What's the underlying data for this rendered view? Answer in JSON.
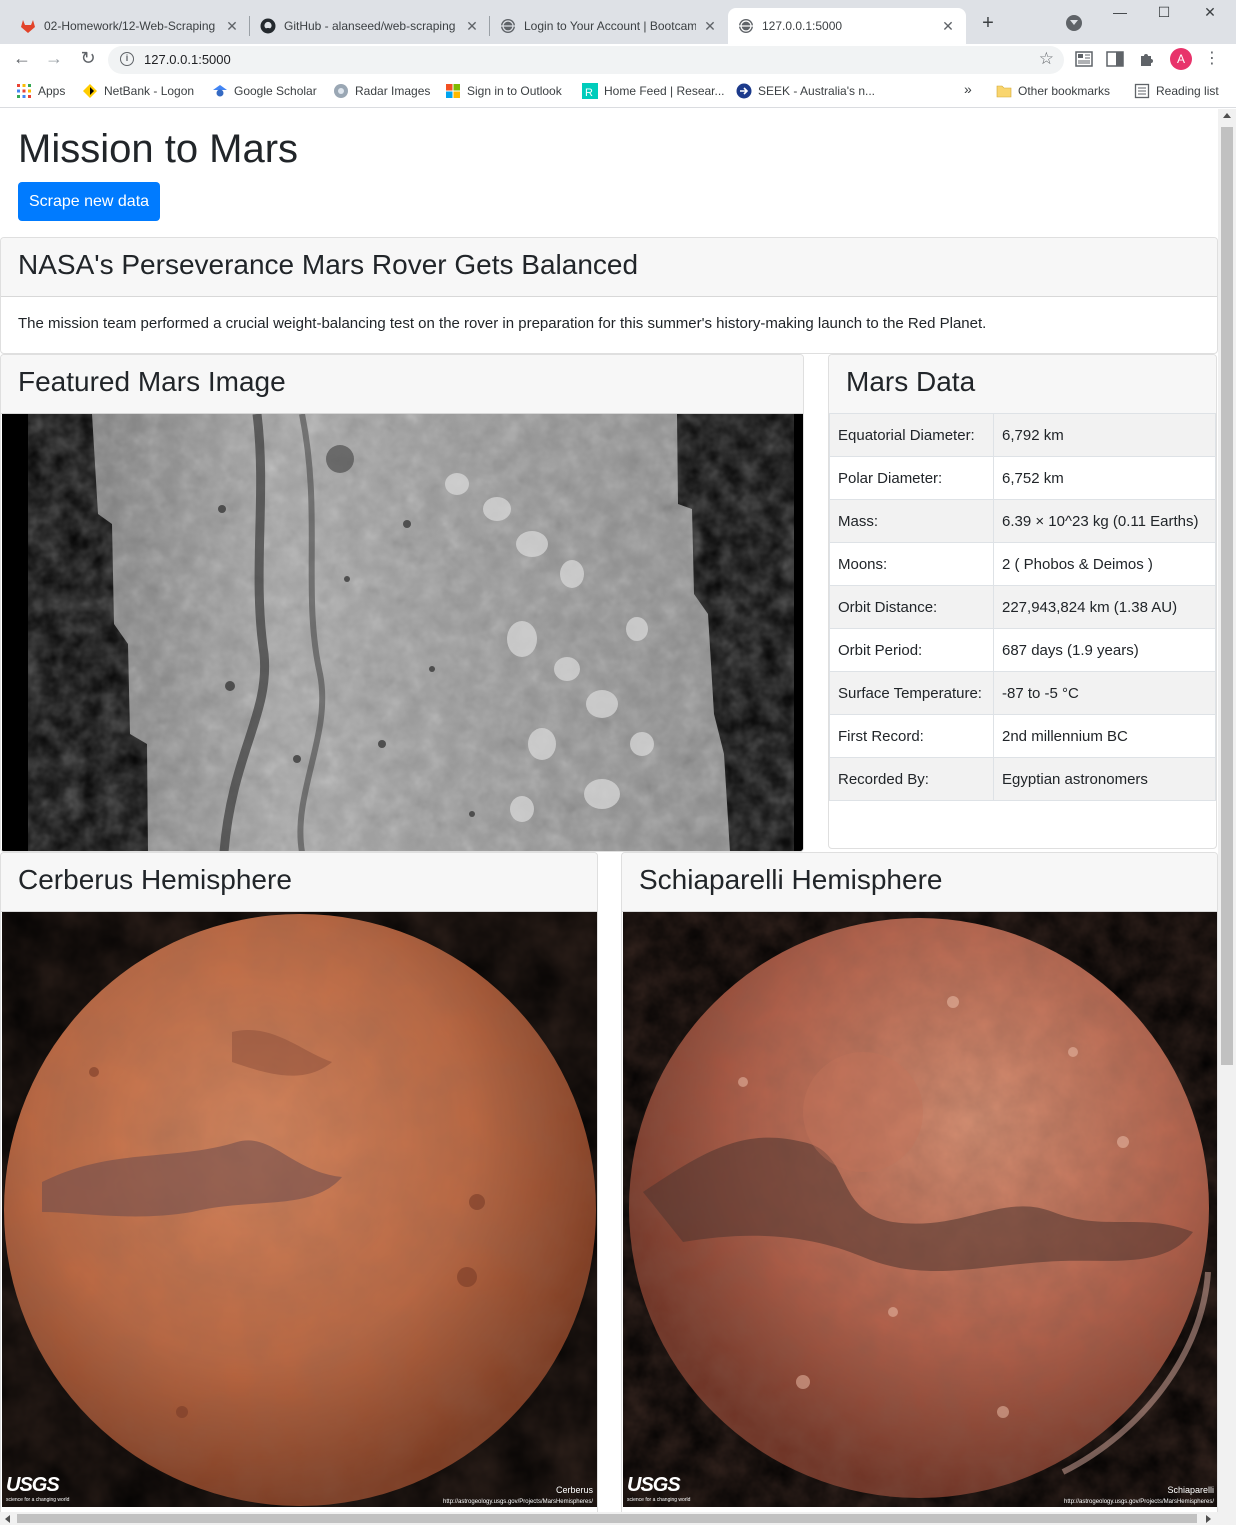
{
  "browser": {
    "tabs": [
      {
        "title": "02-Homework/12-Web-Scraping",
        "active": false
      },
      {
        "title": "GitHub - alanseed/web-scraping",
        "active": false
      },
      {
        "title": "Login to Your Account | Bootcamp",
        "active": false
      },
      {
        "title": "127.0.0.1:5000",
        "active": true
      }
    ],
    "new_tab_label": "+",
    "url": "127.0.0.1:5000",
    "profile_initial": "A",
    "bookmarks": [
      {
        "label": "Apps",
        "icon": "apps-grid-icon"
      },
      {
        "label": "NetBank - Logon",
        "icon": "netbank-icon"
      },
      {
        "label": "Google Scholar",
        "icon": "google-scholar-icon"
      },
      {
        "label": "Radar Images",
        "icon": "radar-icon"
      },
      {
        "label": "Sign in to Outlook",
        "icon": "microsoft-icon"
      },
      {
        "label": "Home Feed | Resear...",
        "icon": "researchgate-icon"
      },
      {
        "label": "SEEK - Australia's n...",
        "icon": "seek-icon"
      }
    ],
    "overflow_label": "»",
    "other_bookmarks": "Other bookmarks",
    "reading_list": "Reading list"
  },
  "page": {
    "title": "Mission to Mars",
    "scrape_button": "Scrape new data",
    "news": {
      "title": "NASA's Perseverance Mars Rover Gets Balanced",
      "paragraph": "The mission team performed a crucial weight-balancing test on the rover in preparation for this summer's history-making launch to the Red Planet."
    },
    "featured_image": {
      "header": "Featured Mars Image"
    },
    "facts": {
      "header": "Mars Data",
      "rows": [
        {
          "label": "Equatorial Diameter:",
          "value": "6,792 km"
        },
        {
          "label": "Polar Diameter:",
          "value": "6,752 km"
        },
        {
          "label": "Mass:",
          "value": "6.39 × 10^23 kg (0.11 Earths)"
        },
        {
          "label": "Moons:",
          "value": "2 ( Phobos & Deimos )"
        },
        {
          "label": "Orbit Distance:",
          "value": "227,943,824 km (1.38 AU)"
        },
        {
          "label": "Orbit Period:",
          "value": "687 days (1.9 years)"
        },
        {
          "label": "Surface Temperature:",
          "value": "-87 to -5 °C"
        },
        {
          "label": "First Record:",
          "value": "2nd millennium BC"
        },
        {
          "label": "Recorded By:",
          "value": "Egyptian astronomers"
        }
      ]
    },
    "hemispheres": [
      {
        "title": "Cerberus Hemisphere",
        "caption": "Cerberus",
        "logo": "USGS",
        "logo_tagline": "science for a changing world",
        "credit": "http://astrogeology.usgs.gov/Projects/MarsHemispheres/"
      },
      {
        "title": "Schiaparelli Hemisphere",
        "caption": "Schiaparelli",
        "logo": "USGS",
        "logo_tagline": "science for a changing world",
        "credit": "http://astrogeology.usgs.gov/Projects/MarsHemispheres/"
      }
    ]
  },
  "colors": {
    "primary": "#007bff",
    "mars": "#b8603b",
    "card_header": "#f7f7f7"
  }
}
